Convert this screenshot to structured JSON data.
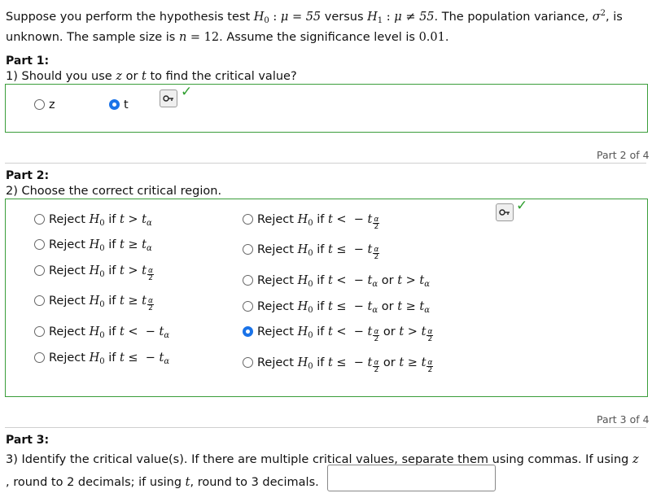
{
  "intro": {
    "line1_a": "Suppose you perform the hypothesis test ",
    "line1_b": " versus ",
    "line1_c": ". The population variance, ",
    "line1_d": ", is",
    "line2_a": "unknown. The sample size is ",
    "line2_b": ". Assume the significance level is ",
    "line2_c": ".",
    "h0_expr": "μ = 55",
    "h1_expr": "μ ≠ 55",
    "n_value": "12",
    "alpha_value": "0.01"
  },
  "part1": {
    "title": "Part 1:",
    "question_a": "1) Should you use ",
    "question_b": " or ",
    "question_c": " to find the critical value?",
    "options": [
      {
        "label": "z",
        "selected": false
      },
      {
        "label": "t",
        "selected": true
      }
    ]
  },
  "part2": {
    "page_of": "Part 2 of 4",
    "title": "Part 2:",
    "question": "2) Choose the correct critical region.",
    "selected_option": "Reject H0 if t < −t_{α/2} or t > t_{α/2}",
    "reject_word": "Reject",
    "if_word": "if",
    "or_word": "or"
  },
  "part3": {
    "page_of": "Part 3 of 4",
    "title": "Part 3:",
    "question_a": "3) Identify the critical value(s). If there are multiple critical values, separate them using commas. If using ",
    "question_b": ", round to 2 decimals; if using ",
    "question_c": ", round to 3 decimals.",
    "input_value": ""
  },
  "colors": {
    "correct_green": "#3a9d3a",
    "selected_blue": "#1a73e8"
  },
  "icons": {
    "key": "key-icon",
    "check": "checkmark-icon"
  }
}
